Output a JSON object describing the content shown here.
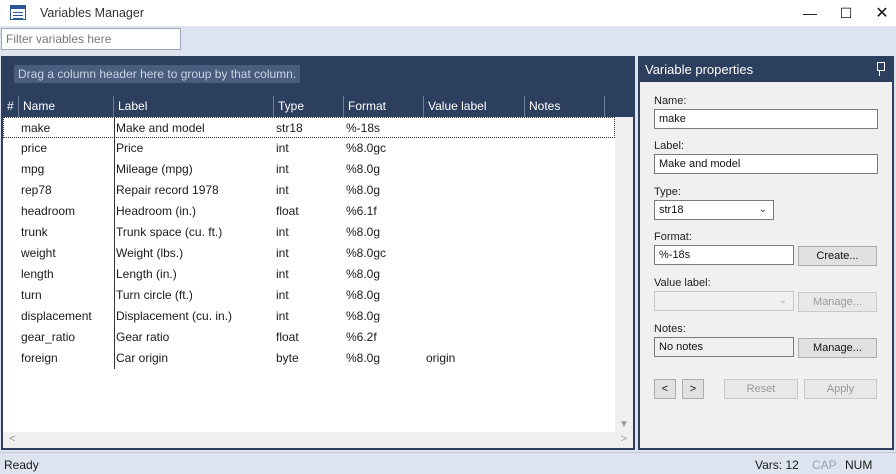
{
  "window": {
    "title": "Variables Manager",
    "app_icon": "table-icon",
    "controls": {
      "minimize": "—",
      "maximize": "☐",
      "close": "✕"
    }
  },
  "filter": {
    "placeholder": "Filter variables here",
    "value": ""
  },
  "grid": {
    "group_hint": "Drag a column header here to group by that column.",
    "columns": [
      "#",
      "Name",
      "Label",
      "Type",
      "Format",
      "Value label",
      "Notes"
    ],
    "rows": [
      {
        "name": "make",
        "label": "Make and model",
        "type": "str18",
        "format": "%-18s",
        "value_label": "",
        "notes": ""
      },
      {
        "name": "price",
        "label": "Price",
        "type": "int",
        "format": "%8.0gc",
        "value_label": "",
        "notes": ""
      },
      {
        "name": "mpg",
        "label": "Mileage (mpg)",
        "type": "int",
        "format": "%8.0g",
        "value_label": "",
        "notes": ""
      },
      {
        "name": "rep78",
        "label": "Repair record 1978",
        "type": "int",
        "format": "%8.0g",
        "value_label": "",
        "notes": ""
      },
      {
        "name": "headroom",
        "label": "Headroom (in.)",
        "type": "float",
        "format": "%6.1f",
        "value_label": "",
        "notes": ""
      },
      {
        "name": "trunk",
        "label": "Trunk space (cu. ft.)",
        "type": "int",
        "format": "%8.0g",
        "value_label": "",
        "notes": ""
      },
      {
        "name": "weight",
        "label": "Weight (lbs.)",
        "type": "int",
        "format": "%8.0gc",
        "value_label": "",
        "notes": ""
      },
      {
        "name": "length",
        "label": "Length (in.)",
        "type": "int",
        "format": "%8.0g",
        "value_label": "",
        "notes": ""
      },
      {
        "name": "turn",
        "label": "Turn circle (ft.)",
        "type": "int",
        "format": "%8.0g",
        "value_label": "",
        "notes": ""
      },
      {
        "name": "displacement",
        "label": "Displacement (cu. in.)",
        "type": "int",
        "format": "%8.0g",
        "value_label": "",
        "notes": ""
      },
      {
        "name": "gear_ratio",
        "label": "Gear ratio",
        "type": "float",
        "format": "%6.2f",
        "value_label": "",
        "notes": ""
      },
      {
        "name": "foreign",
        "label": "Car origin",
        "type": "byte",
        "format": "%8.0g",
        "value_label": "origin",
        "notes": ""
      }
    ],
    "selected_index": 0
  },
  "properties": {
    "title": "Variable properties",
    "name_label": "Name:",
    "name_value": "make",
    "label_label": "Label:",
    "label_value": "Make and model",
    "type_label": "Type:",
    "type_value": "str18",
    "format_label": "Format:",
    "format_value": "%-18s",
    "create_button": "Create...",
    "value_label_label": "Value label:",
    "value_label_value": "",
    "manage_value_button": "Manage...",
    "notes_label": "Notes:",
    "notes_value": "No notes",
    "manage_notes_button": "Manage...",
    "prev_button": "<",
    "next_button": ">",
    "reset_button": "Reset",
    "apply_button": "Apply"
  },
  "status": {
    "ready": "Ready",
    "vars": "Vars: 12",
    "cap": "CAP",
    "num": "NUM"
  },
  "colors": {
    "panel_header": "#2d3f5e",
    "accent": "#2b5797",
    "background": "#dde3ef"
  }
}
